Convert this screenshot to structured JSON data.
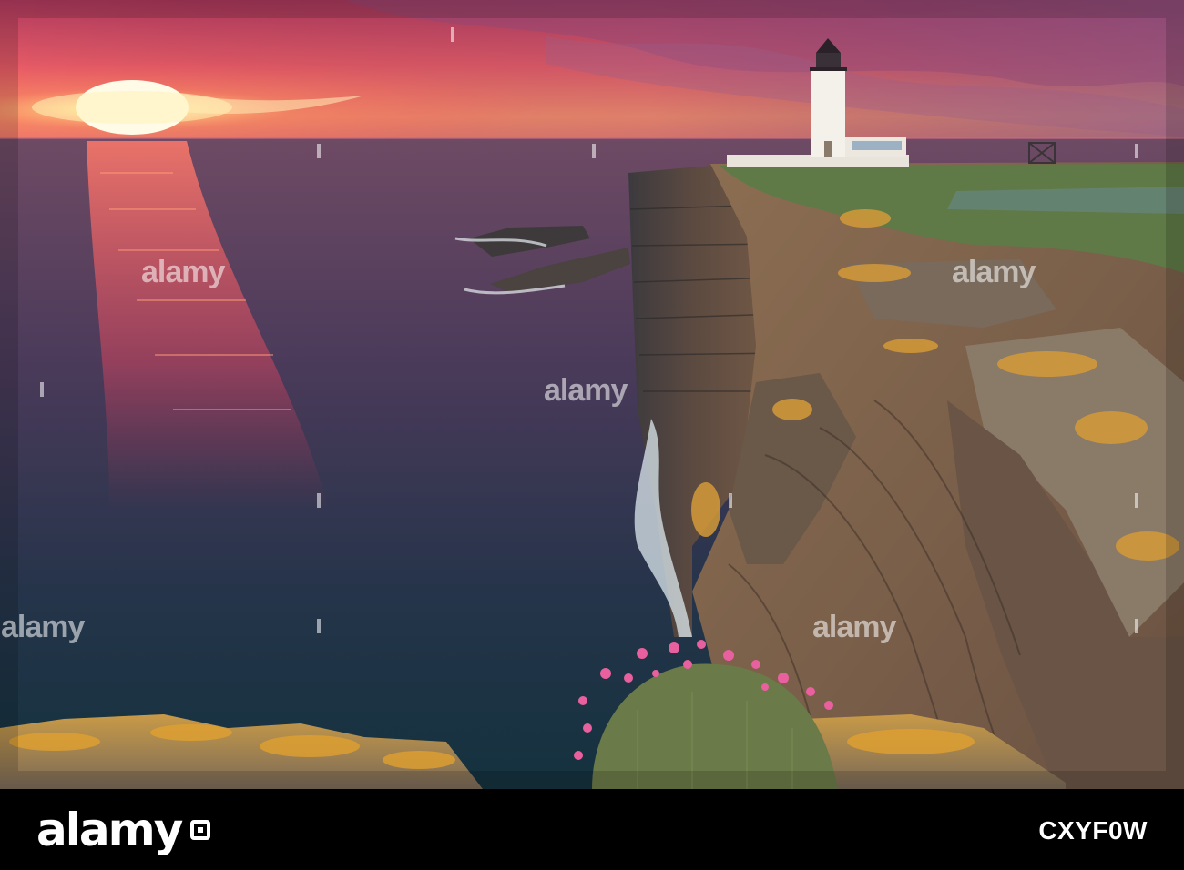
{
  "photo": {
    "subject": "Lighthouse on sea cliff at sunset",
    "colors": {
      "sky_top": "#c9486a",
      "sky_glow": "#f47a5a",
      "sun": "#fff6c8",
      "sea": "#2b2f4a",
      "sea_reflection": "#e0526a",
      "cliff": "#6a5644",
      "lichen": "#d9a23a",
      "grass": "#6e8a4a",
      "lighthouse": "#f2f0ea",
      "flowers": "#e85fa0"
    }
  },
  "watermark": {
    "text": "alamy"
  },
  "footer": {
    "brand": "alamy",
    "image_code": "CXYF0W"
  }
}
